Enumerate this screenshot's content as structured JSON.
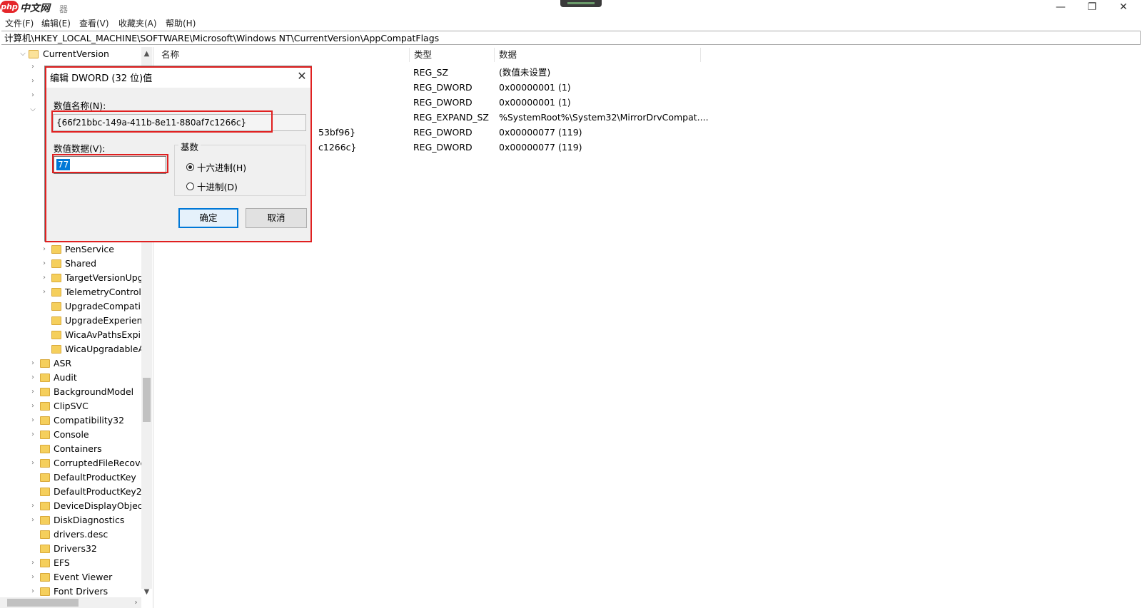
{
  "window": {
    "logo_text": "php",
    "logo_suffix": "中文网",
    "title_ghost": "器",
    "minimize_glyph": "—",
    "restore_glyph": "❐",
    "close_glyph": "✕"
  },
  "menu": [
    "文件(F)",
    "编辑(E)",
    "查看(V)",
    "收藏夹(A)",
    "帮助(H)"
  ],
  "address": "计算机\\HKEY_LOCAL_MACHINE\\SOFTWARE\\Microsoft\\Windows NT\\CurrentVersion\\AppCompatFlags",
  "tree": {
    "root": "CurrentVersion",
    "children": [
      "PenService",
      "Shared",
      "TargetVersionUpg",
      "TelemetryControlle",
      "UpgradeCompatib",
      "UpgradeExperienc",
      "WicaAvPathsExpire",
      "WicaUpgradableA"
    ],
    "siblings": [
      "ASR",
      "Audit",
      "BackgroundModel",
      "ClipSVC",
      "Compatibility32",
      "Console",
      "Containers",
      "CorruptedFileRecove",
      "DefaultProductKey",
      "DefaultProductKey2",
      "DeviceDisplayObjects",
      "DiskDiagnostics",
      "drivers.desc",
      "Drivers32",
      "EFS",
      "Event Viewer",
      "Font Drivers"
    ]
  },
  "list": {
    "headers": {
      "name": "名称",
      "type": "类型",
      "data": "数据"
    },
    "rows": [
      {
        "name": "",
        "type": "REG_SZ",
        "data": "(数值未设置)"
      },
      {
        "name": "",
        "type": "REG_DWORD",
        "data": "0x00000001 (1)"
      },
      {
        "name": "",
        "type": "REG_DWORD",
        "data": "0x00000001 (1)"
      },
      {
        "name": "",
        "type": "REG_EXPAND_SZ",
        "data": "%SystemRoot%\\System32\\MirrorDrvCompat...."
      },
      {
        "name": "53bf96}",
        "type": "REG_DWORD",
        "data": "0x00000077 (119)"
      },
      {
        "name": "c1266c}",
        "type": "REG_DWORD",
        "data": "0x00000077 (119)"
      }
    ]
  },
  "dialog": {
    "title": "编辑 DWORD (32 位)值",
    "name_label": "数值名称(N):",
    "name_value": "{66f21bbc-149a-411b-8e11-880af7c1266c}",
    "data_label": "数值数据(V):",
    "data_value": "77",
    "base_label": "基数",
    "hex_label": "十六进制(H)",
    "dec_label": "十进制(D)",
    "selected_base": "hex",
    "ok": "确定",
    "cancel": "取消"
  },
  "colors": {
    "highlight": "#e02020",
    "folder": "#f5cf5c",
    "selection": "#0078d7"
  }
}
